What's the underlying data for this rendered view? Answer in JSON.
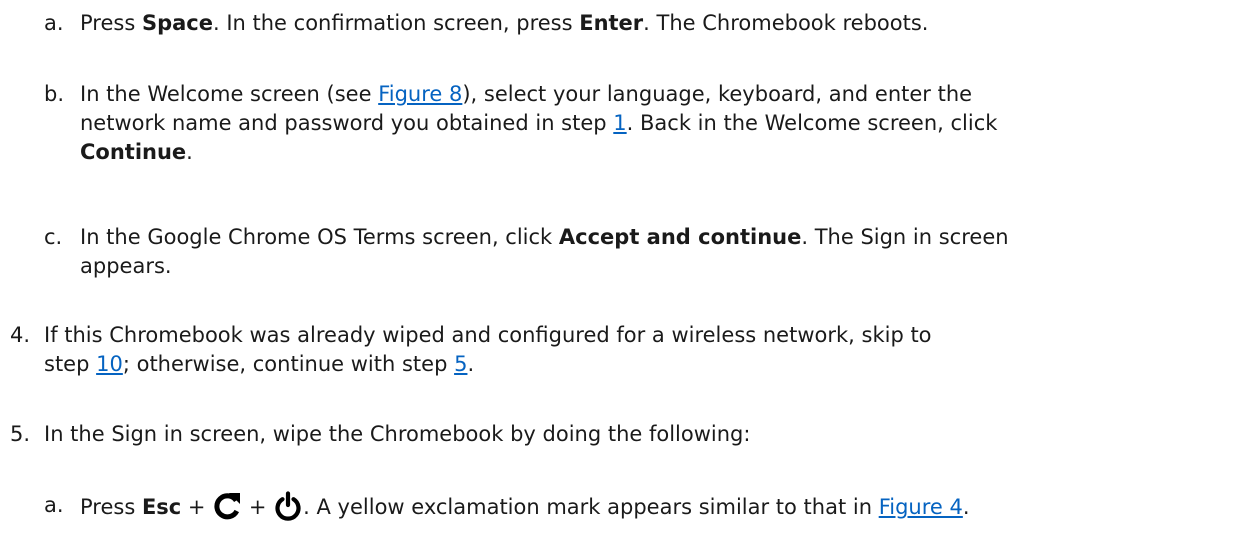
{
  "steps": [
    {
      "marker": "a.",
      "parts": [
        {
          "t": "text",
          "v": "Press "
        },
        {
          "t": "bold",
          "v": "Space"
        },
        {
          "t": "text",
          "v": ". In the confirmation screen, press "
        },
        {
          "t": "bold",
          "v": "Enter"
        },
        {
          "t": "text",
          "v": ". The Chromebook reboots."
        }
      ]
    },
    {
      "marker": "b.",
      "parts": [
        {
          "t": "text",
          "v": "In the Welcome screen (see "
        },
        {
          "t": "link",
          "v": "Figure 8"
        },
        {
          "t": "text",
          "v": "), select your language, keyboard, and enter the"
        },
        {
          "t": "br"
        },
        {
          "t": "text",
          "v": "network name and password you obtained in step "
        },
        {
          "t": "link",
          "v": "1"
        },
        {
          "t": "text",
          "v": ". Back in the Welcome screen, click"
        },
        {
          "t": "br"
        },
        {
          "t": "bold",
          "v": "Continue"
        },
        {
          "t": "text",
          "v": "."
        }
      ]
    },
    {
      "marker": "c.",
      "parts": [
        {
          "t": "text",
          "v": "In the Google Chrome OS Terms screen, click "
        },
        {
          "t": "bold",
          "v": "Accept and continue"
        },
        {
          "t": "text",
          "v": ". The Sign in screen"
        },
        {
          "t": "br"
        },
        {
          "t": "text",
          "v": "appears."
        }
      ]
    },
    {
      "marker": "4.",
      "parts": [
        {
          "t": "text",
          "v": "If this Chromebook was already wiped and configured for a wireless network, skip to"
        },
        {
          "t": "br"
        },
        {
          "t": "text",
          "v": "step "
        },
        {
          "t": "link",
          "v": "10"
        },
        {
          "t": "text",
          "v": "; otherwise, continue with step "
        },
        {
          "t": "link",
          "v": "5"
        },
        {
          "t": "text",
          "v": "."
        }
      ]
    },
    {
      "marker": "5.",
      "parts": [
        {
          "t": "text",
          "v": "In the Sign in screen, wipe the Chromebook by doing the following:"
        }
      ]
    },
    {
      "marker": "a.",
      "parts": [
        {
          "t": "text",
          "v": "Press "
        },
        {
          "t": "bold",
          "v": "Esc"
        },
        {
          "t": "text",
          "v": " + "
        },
        {
          "t": "icon",
          "v": "refresh-icon"
        },
        {
          "t": "text",
          "v": " + "
        },
        {
          "t": "icon",
          "v": "power-icon"
        },
        {
          "t": "text",
          "v": ". A yellow exclamation mark appears similar to that in "
        },
        {
          "t": "link",
          "v": "Figure 4"
        },
        {
          "t": "text",
          "v": "."
        }
      ]
    }
  ],
  "colors": {
    "text": "#1a1a1a",
    "link": "#0563c1"
  }
}
